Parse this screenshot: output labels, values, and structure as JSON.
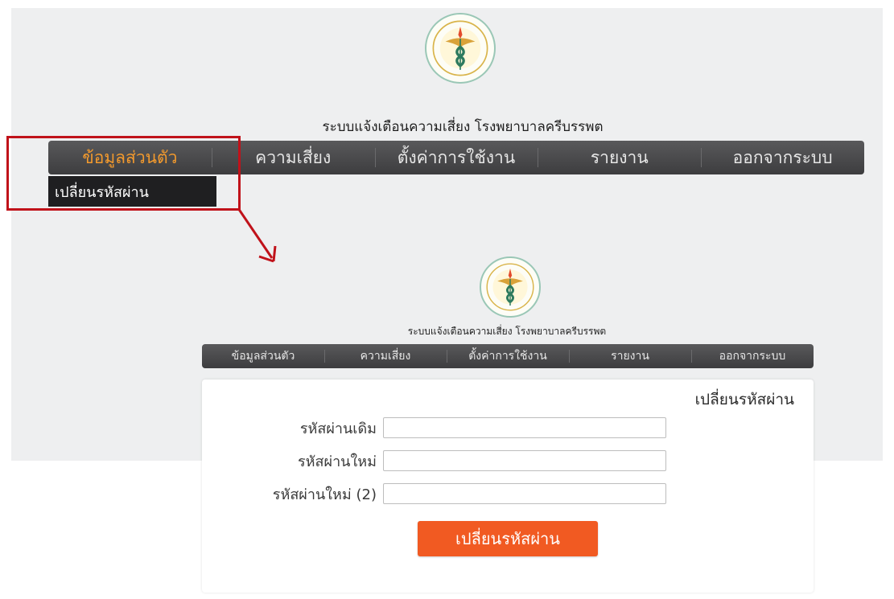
{
  "header": {
    "system_title": "ระบบแจ้งเตือนความเสี่ยง โรงพยาบาลครีบรรพต"
  },
  "nav": {
    "items": [
      "ข้อมูลส่วนตัว",
      "ความเสี่ยง",
      "ตั้งค่าการใช้งาน",
      "รายงาน",
      "ออกจากระบบ"
    ],
    "active_index": 0,
    "dropdown_item": "เปลี่ยนรหัสผ่าน"
  },
  "form": {
    "heading": "เปลี่ยนรหัสผ่าน",
    "old_password_label": "รหัสผ่านเดิม",
    "new_password_label": "รหัสผ่านใหม่",
    "confirm_password_label": "รหัสผ่านใหม่ (2)",
    "submit_label": "เปลี่ยนรหัสผ่าน"
  },
  "colors": {
    "nav_bg": "#4a4a4c",
    "nav_active": "#f39a2d",
    "button": "#f15a22",
    "highlight": "#c0121a",
    "arrow": "#c0121a"
  },
  "icons": {
    "logo": "ministry-of-public-health-seal-icon",
    "arrow": "arrow-down-right-icon"
  }
}
